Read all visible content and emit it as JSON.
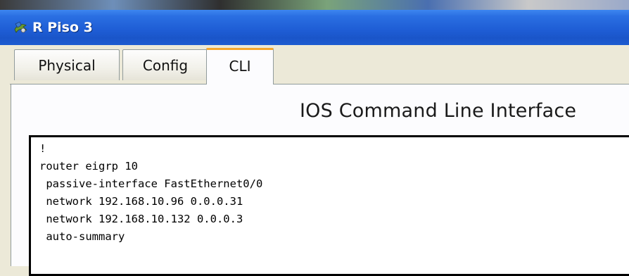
{
  "window": {
    "title": "R Piso 3",
    "icon": "packet-tracer-router-icon"
  },
  "tabs": [
    {
      "label": "Physical",
      "active": false
    },
    {
      "label": "Config",
      "active": false
    },
    {
      "label": "CLI",
      "active": true
    }
  ],
  "cli": {
    "heading": "IOS Command Line Interface",
    "lines": [
      "!",
      "router eigrp 10",
      " passive-interface FastEthernet0/0",
      " network 192.168.10.96 0.0.0.31",
      " network 192.168.10.132 0.0.0.3",
      " auto-summary"
    ]
  },
  "colors": {
    "titlebar": "#2a6fe2",
    "active_tab_accent": "#f6a72c",
    "window_bg": "#ece9d8"
  }
}
